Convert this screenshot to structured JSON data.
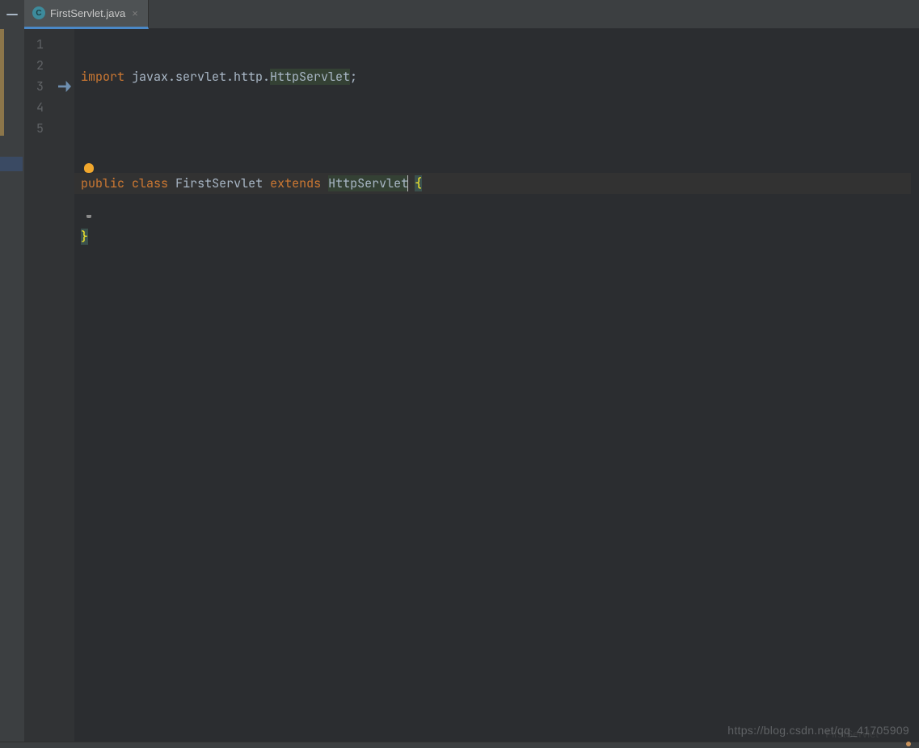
{
  "tab": {
    "filename": "FirstServlet.java",
    "icon_letter": "C"
  },
  "gutter": {
    "lines": [
      "1",
      "2",
      "3",
      "4",
      "5"
    ]
  },
  "code": {
    "line1": {
      "kw_import": "import",
      "pkg_prefix": " javax.servlet.http.",
      "cls": "HttpServlet",
      "semi": ";"
    },
    "line3": {
      "kw_public": "public",
      "kw_class": "class",
      "classname": "FirstServlet",
      "kw_extends": "extends",
      "superclass": "HttpServlet",
      "brace_open": "{"
    },
    "line4": {
      "brace_close": "}"
    }
  },
  "icons": {
    "close": "×",
    "minimize": "—",
    "override": "→"
  },
  "watermark": "https://blog.csdn.net/qq_41705909",
  "breadcrumb_ghost": "FirstServlet"
}
